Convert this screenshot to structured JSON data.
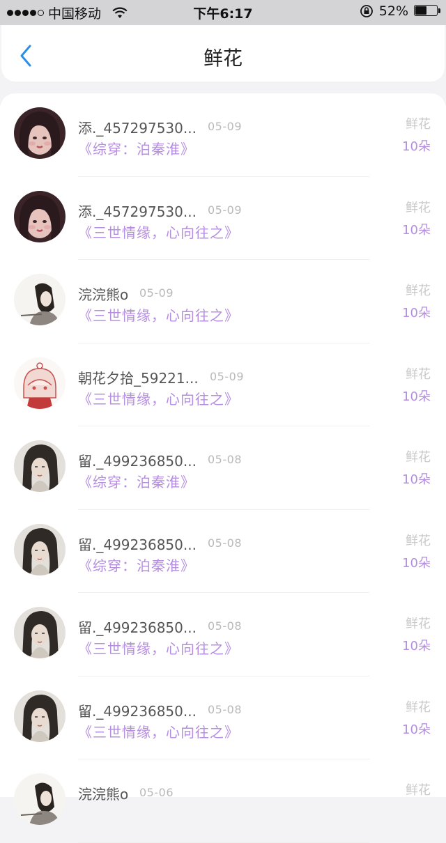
{
  "status_bar": {
    "carrier": "中国移动",
    "time": "下午6:17",
    "battery": "52%",
    "battery_level": 0.52
  },
  "nav": {
    "title": "鲜花",
    "back_icon": "chevron-left-icon",
    "accent": "#2b8fe6"
  },
  "items": [
    {
      "name": "添._457297530...",
      "date": "05-09",
      "book": "《综穿：泊秦淮》",
      "type": "鲜花",
      "count": "10朵",
      "avatar": "girl-dark"
    },
    {
      "name": "添._457297530...",
      "date": "05-09",
      "book": "《三世情缘，心向往之》",
      "type": "鲜花",
      "count": "10朵",
      "avatar": "girl-dark"
    },
    {
      "name": "浣浣熊o",
      "date": "05-09",
      "book": "《三世情缘，心向往之》",
      "type": "鲜花",
      "count": "10朵",
      "avatar": "ink-man"
    },
    {
      "name": "朝花夕拾_59221...",
      "date": "05-09",
      "book": "《三世情缘，心向往之》",
      "type": "鲜花",
      "count": "10朵",
      "avatar": "cartoon-girl"
    },
    {
      "name": "留._499236850...",
      "date": "05-08",
      "book": "《综穿：泊秦淮》",
      "type": "鲜花",
      "count": "10朵",
      "avatar": "ancient-man"
    },
    {
      "name": "留._499236850...",
      "date": "05-08",
      "book": "《综穿：泊秦淮》",
      "type": "鲜花",
      "count": "10朵",
      "avatar": "ancient-man"
    },
    {
      "name": "留._499236850...",
      "date": "05-08",
      "book": "《三世情缘，心向往之》",
      "type": "鲜花",
      "count": "10朵",
      "avatar": "ancient-man"
    },
    {
      "name": "留._499236850...",
      "date": "05-08",
      "book": "《三世情缘，心向往之》",
      "type": "鲜花",
      "count": "10朵",
      "avatar": "ancient-man"
    },
    {
      "name": "浣浣熊o",
      "date": "05-06",
      "book": "",
      "type": "鲜花",
      "count": "",
      "avatar": "ink-man"
    }
  ],
  "colors": {
    "book_title": "#b58ee0",
    "count": "#b58ee0",
    "type": "#c9c9c9",
    "date": "#b9b9b9"
  }
}
